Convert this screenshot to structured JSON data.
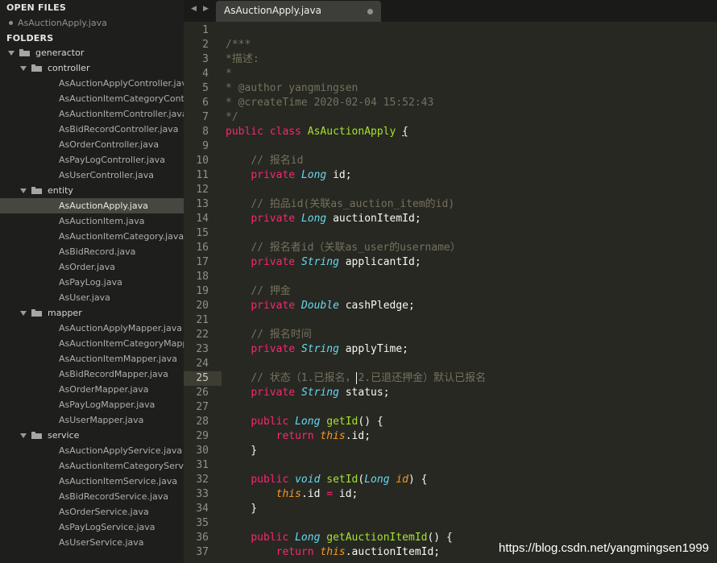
{
  "sidebar": {
    "open_files_header": "OPEN FILES",
    "open_file": "AsAuctionApply.java",
    "folders_header": "FOLDERS",
    "tree": [
      {
        "type": "folder",
        "label": "generactor",
        "depth": 0
      },
      {
        "type": "folder",
        "label": "controller",
        "depth": 1
      },
      {
        "type": "file",
        "label": "AsAuctionApplyController.java"
      },
      {
        "type": "file",
        "label": "AsAuctionItemCategoryController.java"
      },
      {
        "type": "file",
        "label": "AsAuctionItemController.java"
      },
      {
        "type": "file",
        "label": "AsBidRecordController.java"
      },
      {
        "type": "file",
        "label": "AsOrderController.java"
      },
      {
        "type": "file",
        "label": "AsPayLogController.java"
      },
      {
        "type": "file",
        "label": "AsUserController.java"
      },
      {
        "type": "folder",
        "label": "entity",
        "depth": 1
      },
      {
        "type": "file",
        "label": "AsAuctionApply.java",
        "selected": true
      },
      {
        "type": "file",
        "label": "AsAuctionItem.java"
      },
      {
        "type": "file",
        "label": "AsAuctionItemCategory.java"
      },
      {
        "type": "file",
        "label": "AsBidRecord.java"
      },
      {
        "type": "file",
        "label": "AsOrder.java"
      },
      {
        "type": "file",
        "label": "AsPayLog.java"
      },
      {
        "type": "file",
        "label": "AsUser.java"
      },
      {
        "type": "folder",
        "label": "mapper",
        "depth": 1
      },
      {
        "type": "file",
        "label": "AsAuctionApplyMapper.java"
      },
      {
        "type": "file",
        "label": "AsAuctionItemCategoryMapper.java"
      },
      {
        "type": "file",
        "label": "AsAuctionItemMapper.java"
      },
      {
        "type": "file",
        "label": "AsBidRecordMapper.java"
      },
      {
        "type": "file",
        "label": "AsOrderMapper.java"
      },
      {
        "type": "file",
        "label": "AsPayLogMapper.java"
      },
      {
        "type": "file",
        "label": "AsUserMapper.java"
      },
      {
        "type": "folder",
        "label": "service",
        "depth": 1
      },
      {
        "type": "file",
        "label": "AsAuctionApplyService.java"
      },
      {
        "type": "file",
        "label": "AsAuctionItemCategoryService.java"
      },
      {
        "type": "file",
        "label": "AsAuctionItemService.java"
      },
      {
        "type": "file",
        "label": "AsBidRecordService.java"
      },
      {
        "type": "file",
        "label": "AsOrderService.java"
      },
      {
        "type": "file",
        "label": "AsPayLogService.java"
      },
      {
        "type": "file",
        "label": "AsUserService.java"
      }
    ]
  },
  "tabbar": {
    "prev_icon": "◀",
    "next_icon": "▶",
    "active_tab": "AsAuctionApply.java"
  },
  "editor": {
    "active_line": 25,
    "lines": [
      {
        "n": "1",
        "segs": []
      },
      {
        "n": "2",
        "segs": [
          [
            "cmt",
            "/***"
          ]
        ]
      },
      {
        "n": "3",
        "segs": [
          [
            "cmt",
            "*描述:"
          ]
        ]
      },
      {
        "n": "4",
        "segs": [
          [
            "cmt",
            "*"
          ]
        ]
      },
      {
        "n": "5",
        "segs": [
          [
            "cmt",
            "* @author yangmingsen"
          ]
        ]
      },
      {
        "n": "6",
        "segs": [
          [
            "cmt",
            "* @createTime 2020-02-04 15:52:43"
          ]
        ]
      },
      {
        "n": "7",
        "segs": [
          [
            "cmt",
            "*/"
          ]
        ]
      },
      {
        "n": "8",
        "segs": [
          [
            "kw",
            "public"
          ],
          [
            "",
            " "
          ],
          [
            "kw",
            "class"
          ],
          [
            "",
            " "
          ],
          [
            "cls",
            "AsAuctionApply"
          ],
          [
            "",
            " "
          ],
          [
            "brace-u",
            "{"
          ]
        ]
      },
      {
        "n": "9",
        "segs": []
      },
      {
        "n": "10",
        "segs": [
          [
            "",
            "    "
          ],
          [
            "cmt",
            "// 报名id"
          ]
        ]
      },
      {
        "n": "11",
        "segs": [
          [
            "",
            "    "
          ],
          [
            "kw",
            "private"
          ],
          [
            "",
            " "
          ],
          [
            "typ",
            "Long"
          ],
          [
            "",
            " id;"
          ]
        ]
      },
      {
        "n": "12",
        "segs": []
      },
      {
        "n": "13",
        "segs": [
          [
            "",
            "    "
          ],
          [
            "cmt",
            "// 拍品id(关联as_auction_item的id)"
          ]
        ]
      },
      {
        "n": "14",
        "segs": [
          [
            "",
            "    "
          ],
          [
            "kw",
            "private"
          ],
          [
            "",
            " "
          ],
          [
            "typ",
            "Long"
          ],
          [
            "",
            " auctionItemId;"
          ]
        ]
      },
      {
        "n": "15",
        "segs": []
      },
      {
        "n": "16",
        "segs": [
          [
            "",
            "    "
          ],
          [
            "cmt",
            "// 报名者id（关联as_user的username）"
          ]
        ]
      },
      {
        "n": "17",
        "segs": [
          [
            "",
            "    "
          ],
          [
            "kw",
            "private"
          ],
          [
            "",
            " "
          ],
          [
            "typ",
            "String"
          ],
          [
            "",
            " applicantId;"
          ]
        ]
      },
      {
        "n": "18",
        "segs": []
      },
      {
        "n": "19",
        "segs": [
          [
            "",
            "    "
          ],
          [
            "cmt",
            "// 押金"
          ]
        ]
      },
      {
        "n": "20",
        "segs": [
          [
            "",
            "    "
          ],
          [
            "kw",
            "private"
          ],
          [
            "",
            " "
          ],
          [
            "typ",
            "Double"
          ],
          [
            "",
            " cashPledge;"
          ]
        ]
      },
      {
        "n": "21",
        "segs": []
      },
      {
        "n": "22",
        "segs": [
          [
            "",
            "    "
          ],
          [
            "cmt",
            "// 报名时间"
          ]
        ]
      },
      {
        "n": "23",
        "segs": [
          [
            "",
            "    "
          ],
          [
            "kw",
            "private"
          ],
          [
            "",
            " "
          ],
          [
            "typ",
            "String"
          ],
          [
            "",
            " applyTime;"
          ]
        ]
      },
      {
        "n": "24",
        "segs": []
      },
      {
        "n": "25",
        "segs": [
          [
            "",
            "    "
          ],
          [
            "cmt",
            "// 状态（1.已报名，"
          ],
          [
            "cursor",
            ""
          ],
          [
            "cmt",
            "2.已退还押金）默认已报名"
          ]
        ]
      },
      {
        "n": "26",
        "segs": [
          [
            "",
            "    "
          ],
          [
            "kw",
            "private"
          ],
          [
            "",
            " "
          ],
          [
            "typ",
            "String"
          ],
          [
            "",
            " status;"
          ]
        ]
      },
      {
        "n": "27",
        "segs": []
      },
      {
        "n": "28",
        "segs": [
          [
            "",
            "    "
          ],
          [
            "kw",
            "public"
          ],
          [
            "",
            " "
          ],
          [
            "typ",
            "Long"
          ],
          [
            "",
            " "
          ],
          [
            "fn",
            "getId"
          ],
          [
            "",
            "() {"
          ]
        ]
      },
      {
        "n": "29",
        "segs": [
          [
            "",
            "        "
          ],
          [
            "kw",
            "return"
          ],
          [
            "",
            " "
          ],
          [
            "self",
            "this"
          ],
          [
            "",
            ".id;"
          ]
        ]
      },
      {
        "n": "30",
        "segs": [
          [
            "",
            "    }"
          ]
        ]
      },
      {
        "n": "31",
        "segs": []
      },
      {
        "n": "32",
        "segs": [
          [
            "",
            "    "
          ],
          [
            "kw",
            "public"
          ],
          [
            "",
            " "
          ],
          [
            "typ",
            "void"
          ],
          [
            "",
            " "
          ],
          [
            "fn",
            "setId"
          ],
          [
            "",
            "("
          ],
          [
            "typ",
            "Long"
          ],
          [
            "",
            " "
          ],
          [
            "prm",
            "id"
          ],
          [
            "",
            ") {"
          ]
        ]
      },
      {
        "n": "33",
        "segs": [
          [
            "",
            "        "
          ],
          [
            "self",
            "this"
          ],
          [
            "",
            ".id "
          ],
          [
            "kw",
            "="
          ],
          [
            "",
            " id;"
          ]
        ]
      },
      {
        "n": "34",
        "segs": [
          [
            "",
            "    }"
          ]
        ]
      },
      {
        "n": "35",
        "segs": []
      },
      {
        "n": "36",
        "segs": [
          [
            "",
            "    "
          ],
          [
            "kw",
            "public"
          ],
          [
            "",
            " "
          ],
          [
            "typ",
            "Long"
          ],
          [
            "",
            " "
          ],
          [
            "fn",
            "getAuctionItemId"
          ],
          [
            "",
            "() {"
          ]
        ]
      },
      {
        "n": "37",
        "segs": [
          [
            "",
            "        "
          ],
          [
            "kw",
            "return"
          ],
          [
            "",
            " "
          ],
          [
            "self",
            "this"
          ],
          [
            "",
            ".auctionItemId;"
          ]
        ]
      }
    ]
  },
  "watermark": "https://blog.csdn.net/yangmingsen1999"
}
